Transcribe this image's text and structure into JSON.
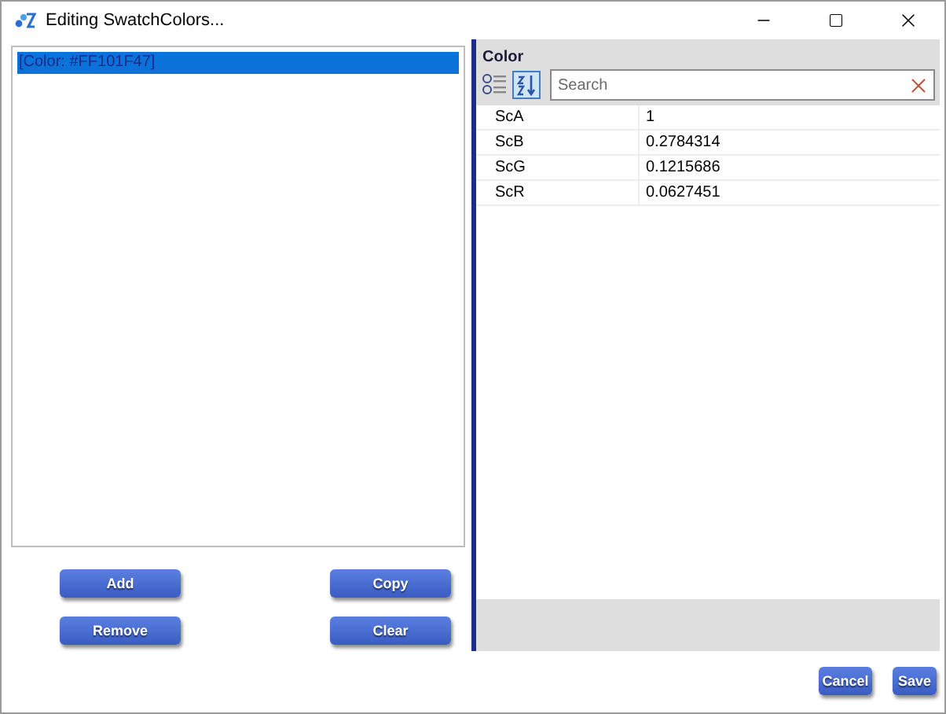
{
  "window": {
    "title": "Editing SwatchColors..."
  },
  "list": {
    "items": [
      {
        "label": "[Color: #FF101F47]",
        "selected": true
      }
    ]
  },
  "list_buttons": [
    "Add",
    "Copy",
    "Remove",
    "Clear"
  ],
  "property_grid": {
    "header": "Color",
    "sort_alphabetical": true,
    "search": {
      "placeholder": "Search"
    },
    "rows": [
      {
        "name": "ScA",
        "value": "1"
      },
      {
        "name": "ScB",
        "value": "0.2784314"
      },
      {
        "name": "ScG",
        "value": "0.1215686"
      },
      {
        "name": "ScR",
        "value": "0.0627451"
      }
    ]
  },
  "dialog_buttons": [
    "Cancel",
    "Save"
  ]
}
